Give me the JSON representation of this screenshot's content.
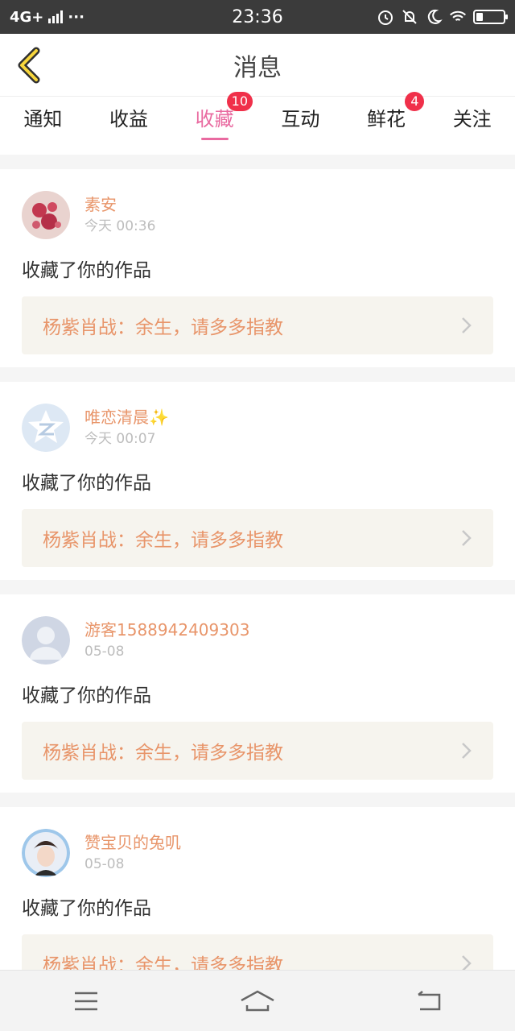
{
  "status_bar": {
    "network": "4G+",
    "more": "···",
    "time": "23:36",
    "icons": [
      "alarm-icon",
      "bell-off-icon",
      "moon-icon",
      "wifi-icon",
      "battery-icon"
    ],
    "battery_level": 0.25
  },
  "header": {
    "title": "消息",
    "back_icon": "chevron-left-icon"
  },
  "tabs": [
    {
      "label": "通知",
      "badge": ""
    },
    {
      "label": "收益",
      "badge": ""
    },
    {
      "label": "收藏",
      "badge": "10",
      "active": true
    },
    {
      "label": "互动",
      "badge": ""
    },
    {
      "label": "鲜花",
      "badge": "4"
    },
    {
      "label": "关注",
      "badge": ""
    }
  ],
  "colors": {
    "accent": "#e96aa0",
    "badge": "#f0304a",
    "username": "#e8956a",
    "work_bg": "#f6f4ee"
  },
  "messages": [
    {
      "username": "素安",
      "time": "今天 00:36",
      "text": "收藏了你的作品",
      "work": "杨紫肖战：余生，请多多指教",
      "avatar": "flower-avatar"
    },
    {
      "username": "唯恋清晨✨",
      "time": "今天 00:07",
      "text": "收藏了你的作品",
      "work": "杨紫肖战：余生，请多多指教",
      "avatar": "qzone-avatar"
    },
    {
      "username": "游客1588942409303",
      "time": "05-08",
      "text": "收藏了你的作品",
      "work": "杨紫肖战：余生，请多多指教",
      "avatar": "default-user-avatar"
    },
    {
      "username": "赞宝贝的兔叽",
      "time": "05-08",
      "text": "收藏了你的作品",
      "work": "杨紫肖战：余生，请多多指教",
      "avatar": "photo-avatar"
    }
  ],
  "nav_bar": {
    "buttons": [
      "menu-icon",
      "home-icon",
      "back-icon"
    ]
  }
}
